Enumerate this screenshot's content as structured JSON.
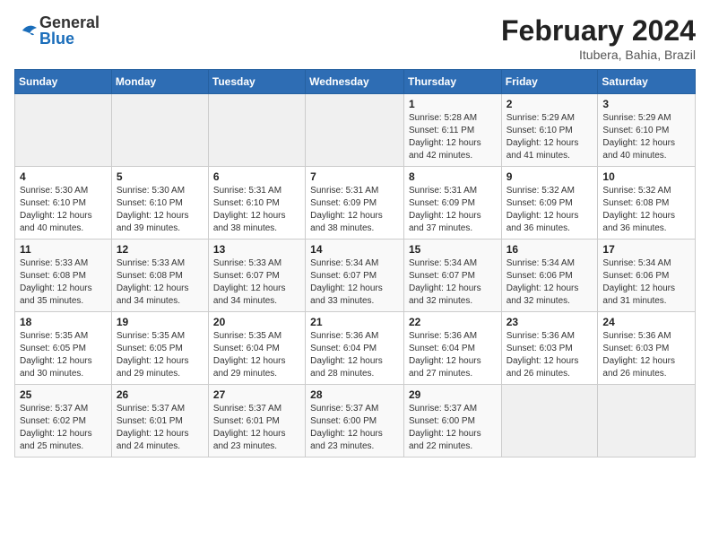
{
  "header": {
    "logo_general": "General",
    "logo_blue": "Blue",
    "month_year": "February 2024",
    "location": "Itubera, Bahia, Brazil"
  },
  "days_of_week": [
    "Sunday",
    "Monday",
    "Tuesday",
    "Wednesday",
    "Thursday",
    "Friday",
    "Saturday"
  ],
  "weeks": [
    [
      {
        "day": "",
        "empty": true
      },
      {
        "day": "",
        "empty": true
      },
      {
        "day": "",
        "empty": true
      },
      {
        "day": "",
        "empty": true
      },
      {
        "day": "1",
        "sunrise": "5:28 AM",
        "sunset": "6:11 PM",
        "daylight": "12 hours and 42 minutes."
      },
      {
        "day": "2",
        "sunrise": "5:29 AM",
        "sunset": "6:10 PM",
        "daylight": "12 hours and 41 minutes."
      },
      {
        "day": "3",
        "sunrise": "5:29 AM",
        "sunset": "6:10 PM",
        "daylight": "12 hours and 40 minutes."
      }
    ],
    [
      {
        "day": "4",
        "sunrise": "5:30 AM",
        "sunset": "6:10 PM",
        "daylight": "12 hours and 40 minutes."
      },
      {
        "day": "5",
        "sunrise": "5:30 AM",
        "sunset": "6:10 PM",
        "daylight": "12 hours and 39 minutes."
      },
      {
        "day": "6",
        "sunrise": "5:31 AM",
        "sunset": "6:10 PM",
        "daylight": "12 hours and 38 minutes."
      },
      {
        "day": "7",
        "sunrise": "5:31 AM",
        "sunset": "6:09 PM",
        "daylight": "12 hours and 38 minutes."
      },
      {
        "day": "8",
        "sunrise": "5:31 AM",
        "sunset": "6:09 PM",
        "daylight": "12 hours and 37 minutes."
      },
      {
        "day": "9",
        "sunrise": "5:32 AM",
        "sunset": "6:09 PM",
        "daylight": "12 hours and 36 minutes."
      },
      {
        "day": "10",
        "sunrise": "5:32 AM",
        "sunset": "6:08 PM",
        "daylight": "12 hours and 36 minutes."
      }
    ],
    [
      {
        "day": "11",
        "sunrise": "5:33 AM",
        "sunset": "6:08 PM",
        "daylight": "12 hours and 35 minutes."
      },
      {
        "day": "12",
        "sunrise": "5:33 AM",
        "sunset": "6:08 PM",
        "daylight": "12 hours and 34 minutes."
      },
      {
        "day": "13",
        "sunrise": "5:33 AM",
        "sunset": "6:07 PM",
        "daylight": "12 hours and 34 minutes."
      },
      {
        "day": "14",
        "sunrise": "5:34 AM",
        "sunset": "6:07 PM",
        "daylight": "12 hours and 33 minutes."
      },
      {
        "day": "15",
        "sunrise": "5:34 AM",
        "sunset": "6:07 PM",
        "daylight": "12 hours and 32 minutes."
      },
      {
        "day": "16",
        "sunrise": "5:34 AM",
        "sunset": "6:06 PM",
        "daylight": "12 hours and 32 minutes."
      },
      {
        "day": "17",
        "sunrise": "5:34 AM",
        "sunset": "6:06 PM",
        "daylight": "12 hours and 31 minutes."
      }
    ],
    [
      {
        "day": "18",
        "sunrise": "5:35 AM",
        "sunset": "6:05 PM",
        "daylight": "12 hours and 30 minutes."
      },
      {
        "day": "19",
        "sunrise": "5:35 AM",
        "sunset": "6:05 PM",
        "daylight": "12 hours and 29 minutes."
      },
      {
        "day": "20",
        "sunrise": "5:35 AM",
        "sunset": "6:04 PM",
        "daylight": "12 hours and 29 minutes."
      },
      {
        "day": "21",
        "sunrise": "5:36 AM",
        "sunset": "6:04 PM",
        "daylight": "12 hours and 28 minutes."
      },
      {
        "day": "22",
        "sunrise": "5:36 AM",
        "sunset": "6:04 PM",
        "daylight": "12 hours and 27 minutes."
      },
      {
        "day": "23",
        "sunrise": "5:36 AM",
        "sunset": "6:03 PM",
        "daylight": "12 hours and 26 minutes."
      },
      {
        "day": "24",
        "sunrise": "5:36 AM",
        "sunset": "6:03 PM",
        "daylight": "12 hours and 26 minutes."
      }
    ],
    [
      {
        "day": "25",
        "sunrise": "5:37 AM",
        "sunset": "6:02 PM",
        "daylight": "12 hours and 25 minutes."
      },
      {
        "day": "26",
        "sunrise": "5:37 AM",
        "sunset": "6:01 PM",
        "daylight": "12 hours and 24 minutes."
      },
      {
        "day": "27",
        "sunrise": "5:37 AM",
        "sunset": "6:01 PM",
        "daylight": "12 hours and 23 minutes."
      },
      {
        "day": "28",
        "sunrise": "5:37 AM",
        "sunset": "6:00 PM",
        "daylight": "12 hours and 23 minutes."
      },
      {
        "day": "29",
        "sunrise": "5:37 AM",
        "sunset": "6:00 PM",
        "daylight": "12 hours and 22 minutes."
      },
      {
        "day": "",
        "empty": true
      },
      {
        "day": "",
        "empty": true
      }
    ]
  ],
  "labels": {
    "sunrise_prefix": "Sunrise: ",
    "sunset_prefix": "Sunset: ",
    "daylight_prefix": "Daylight: "
  }
}
